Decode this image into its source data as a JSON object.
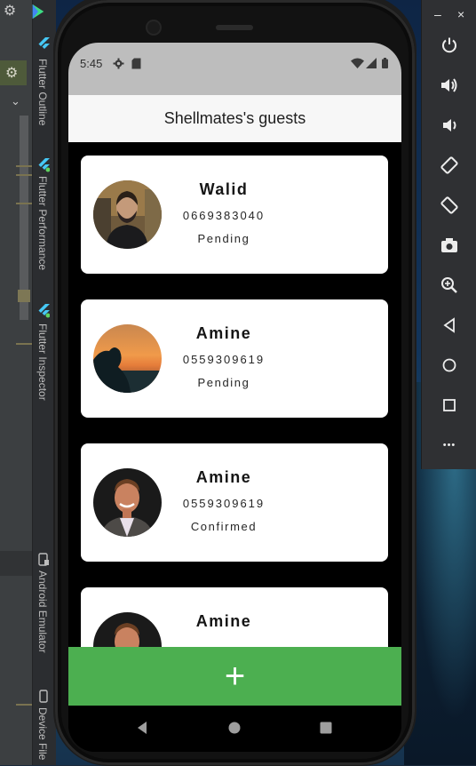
{
  "ide": {
    "panels": [
      {
        "label": "Flutter Outline"
      },
      {
        "label": "Flutter Performance"
      },
      {
        "label": "Flutter Inspector"
      },
      {
        "label": "Android Emulator"
      },
      {
        "label": "Device File"
      }
    ]
  },
  "emulator": {
    "minimize_label": "–",
    "close_label": "×",
    "tools": [
      "power-icon",
      "volume-up-icon",
      "volume-down-icon",
      "rotate-left-icon",
      "rotate-right-icon",
      "camera-icon",
      "zoom-icon",
      "back-icon",
      "home-icon",
      "overview-icon",
      "more-icon"
    ],
    "more_label": "•••"
  },
  "status_bar": {
    "time": "5:45"
  },
  "app": {
    "title": "Shellmates's guests",
    "add_label": "+",
    "guests": [
      {
        "name": "Walid",
        "phone": "0669383040",
        "status": "Pending",
        "avatar": "bearded-man"
      },
      {
        "name": "Amine",
        "phone": "0559309619",
        "status": "Pending",
        "avatar": "sunset-silhouette"
      },
      {
        "name": "Amine",
        "phone": "0559309619",
        "status": "Confirmed",
        "avatar": "smiling-man-suit"
      },
      {
        "name": "Amine",
        "phone": "",
        "status": "",
        "avatar": "smiling-man-suit"
      }
    ]
  },
  "colors": {
    "accent_green": "#4caf50",
    "appbar_bg": "#f7f7f7",
    "status_bar_bg": "#bdbdbd"
  }
}
